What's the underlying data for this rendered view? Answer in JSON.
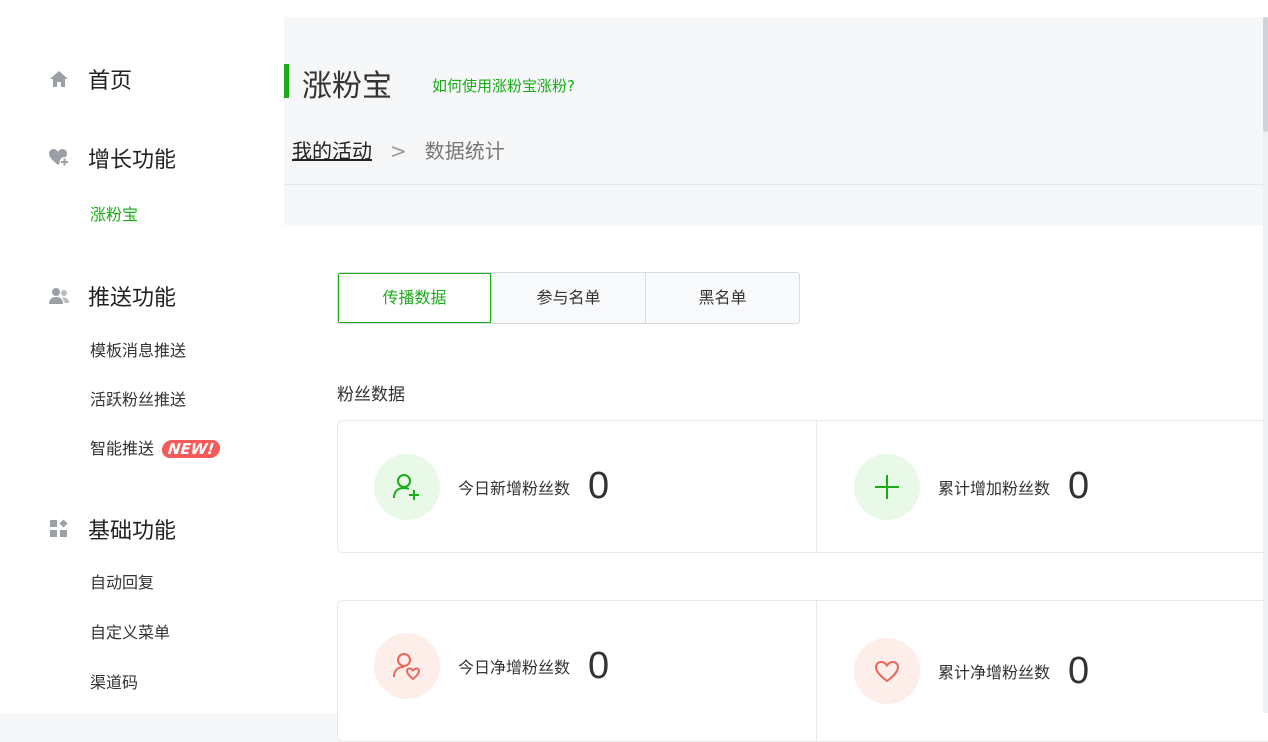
{
  "sidebar": {
    "home": "首页",
    "growth": {
      "label": "增长功能",
      "items": [
        "涨粉宝"
      ]
    },
    "push": {
      "label": "推送功能",
      "items": [
        "模板消息推送",
        "活跃粉丝推送",
        "智能推送"
      ],
      "new_badge": "NEW!"
    },
    "basic": {
      "label": "基础功能",
      "items": [
        "自动回复",
        "自定义菜单",
        "渠道码"
      ]
    }
  },
  "header": {
    "title": "涨粉宝",
    "help_link": "如何使用涨粉宝涨粉?",
    "breadcrumb": {
      "parent": "我的活动",
      "separator": ">",
      "current": "数据统计"
    }
  },
  "tabs": [
    "传播数据",
    "参与名单",
    "黑名单"
  ],
  "section_title": "粉丝数据",
  "stats": [
    {
      "label": "今日新增粉丝数",
      "value": "0",
      "icon": "user-plus-icon"
    },
    {
      "label": "累计增加粉丝数",
      "value": "0",
      "icon": "plus-icon"
    },
    {
      "label": "今日净增粉丝数",
      "value": "0",
      "icon": "user-heart-icon"
    },
    {
      "label": "累计净增粉丝数",
      "value": "0",
      "icon": "heart-icon"
    }
  ],
  "colors": {
    "accent": "#1aad19",
    "badge": "#f55b5b",
    "pink_icon": "#e8675f"
  }
}
